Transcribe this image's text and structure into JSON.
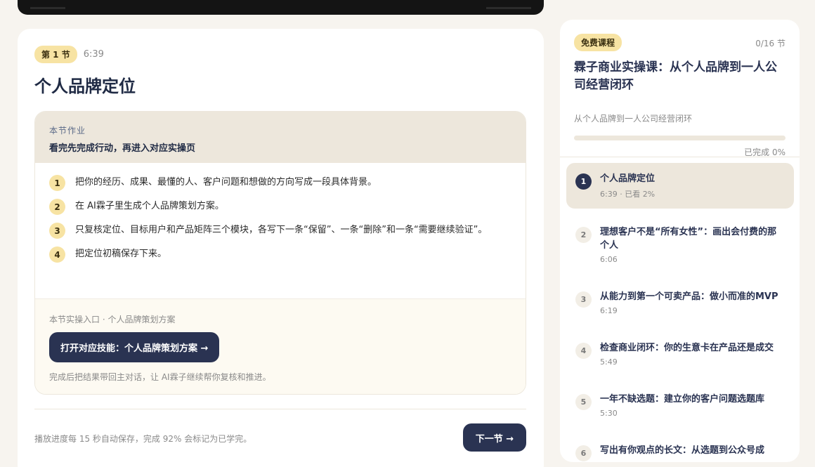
{
  "lesson": {
    "badge": "第 1 节",
    "duration": "6:39",
    "title": "个人品牌定位"
  },
  "homework": {
    "kicker": "本节作业",
    "subtitle": "看完先完成行动，再进入对应实操页",
    "steps": [
      {
        "num": "1",
        "text": "把你的经历、成果、最懂的人、客户问题和想做的方向写成一段具体背景。"
      },
      {
        "num": "2",
        "text": "在 AI霖子里生成个人品牌策划方案。"
      },
      {
        "num": "3",
        "text": "只复核定位、目标用户和产品矩阵三个模块，各写下一条“保留”、一条“删除”和一条“需要继续验证”。"
      },
      {
        "num": "4",
        "text": "把定位初稿保存下来。"
      }
    ]
  },
  "practice": {
    "label": "本节实操入口 · 个人品牌策划方案",
    "button": "打开对应技能：个人品牌策划方案 →",
    "note": "完成后把结果带回主对话，让 AI霖子继续帮你复核和推进。"
  },
  "footer": {
    "autosave": "播放进度每 15 秒自动保存，完成 92% 会标记为已学完。",
    "next": "下一节 →"
  },
  "course": {
    "free_badge": "免费课程",
    "count": "0/16 节",
    "title": "霖子商业实操课：从个人品牌到一人公司经营闭环",
    "subtitle": "从个人品牌到一人公司经营闭环",
    "progress_percent": 0,
    "progress_text": "已完成 0%"
  },
  "lessons": [
    {
      "num": "1",
      "title": "个人品牌定位",
      "meta": "6:39 · 已看 2%",
      "active": true
    },
    {
      "num": "2",
      "title": "理想客户不是“所有女性”：画出会付费的那个人",
      "meta": "6:06"
    },
    {
      "num": "3",
      "title": "从能力到第一个可卖产品：做小而准的MVP",
      "meta": "6:19"
    },
    {
      "num": "4",
      "title": "检查商业闭环：你的生意卡在产品还是成交",
      "meta": "5:49"
    },
    {
      "num": "5",
      "title": "一年不缺选题：建立你的客户问题选题库",
      "meta": "5:30"
    },
    {
      "num": "6",
      "title": "写出有你观点的长文：从选题到公众号成",
      "meta": ""
    }
  ],
  "colors": {
    "navy": "#2a3352",
    "accent_yellow": "#f7e3a3",
    "beige": "#ede7dc"
  }
}
